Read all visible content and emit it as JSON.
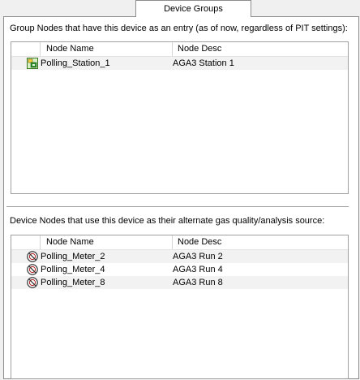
{
  "tab": {
    "label": "Device Groups"
  },
  "group_section": {
    "description": "Group Nodes that have this device as an entry (as of now, regardless of PIT settings):",
    "columns": [
      "Node Name",
      "Node Desc"
    ],
    "rows": [
      {
        "name": "Polling_Station_1",
        "desc": "AGA3 Station 1",
        "icon": "group-node-icon"
      }
    ]
  },
  "device_section": {
    "description": "Device Nodes that use this device as their alternate gas quality/analysis source:",
    "columns": [
      "Node Name",
      "Node Desc"
    ],
    "rows": [
      {
        "name": "Polling_Meter_2",
        "desc": "AGA3 Run 2",
        "icon": "meter-node-icon"
      },
      {
        "name": "Polling_Meter_4",
        "desc": "AGA3 Run 4",
        "icon": "meter-node-icon"
      },
      {
        "name": "Polling_Meter_8",
        "desc": "AGA3 Run 8",
        "icon": "meter-node-icon"
      }
    ]
  }
}
